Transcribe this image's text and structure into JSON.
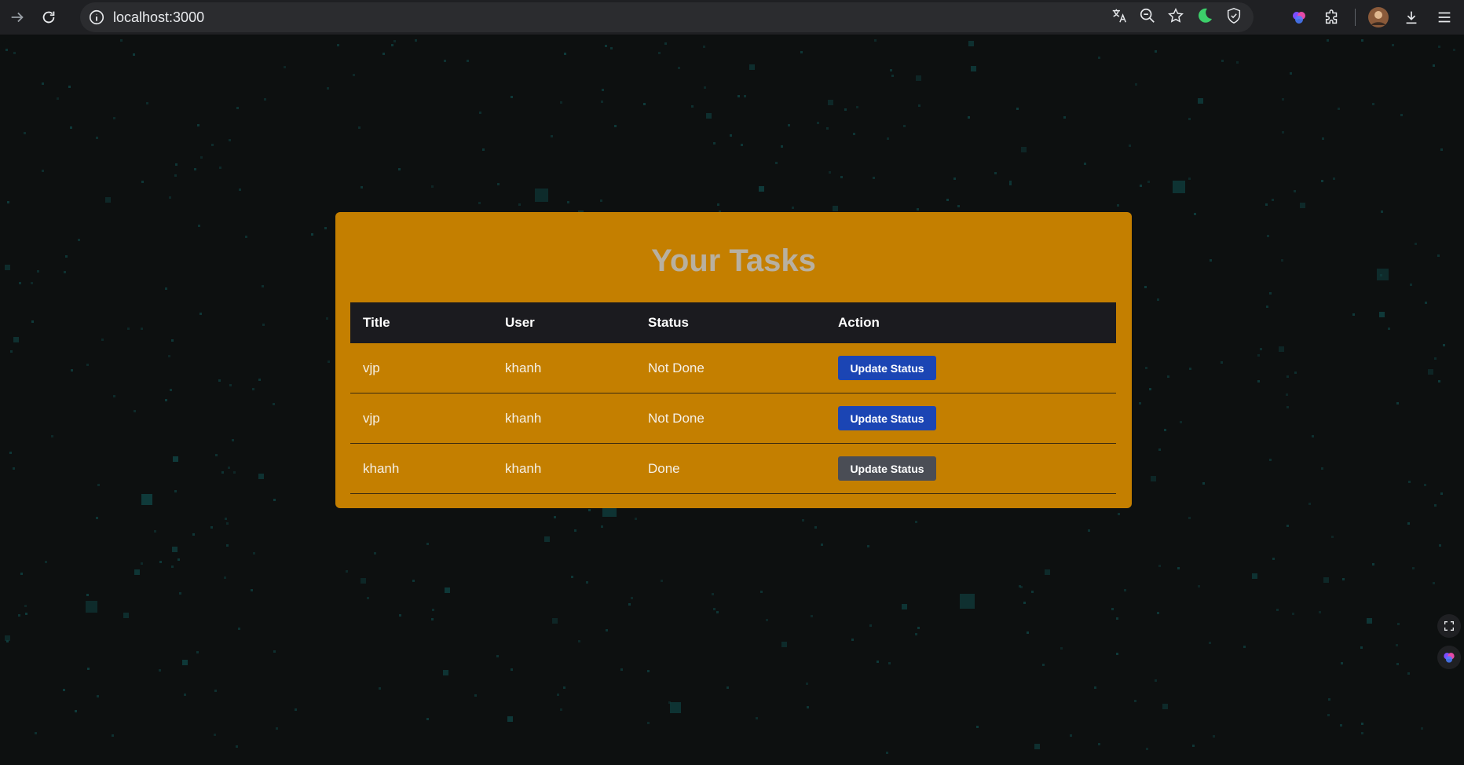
{
  "browser": {
    "url": "localhost:3000"
  },
  "page": {
    "title": "Your Tasks",
    "headers": [
      "Title",
      "User",
      "Status",
      "Action"
    ],
    "rows": [
      {
        "title": "vjp",
        "user": "khanh",
        "status": "Not Done",
        "action": "Update Status",
        "button_color": "#1b45b4"
      },
      {
        "title": "vjp",
        "user": "khanh",
        "status": "Not Done",
        "action": "Update Status",
        "button_color": "#1b45b4"
      },
      {
        "title": "khanh",
        "user": "khanh",
        "status": "Done",
        "action": "Update Status",
        "button_color": "#4a4d55"
      }
    ]
  },
  "colors": {
    "card": "#c47f00",
    "header_bg": "#1b1b1f",
    "background": "#0d1010",
    "speck": "#0f3b3b"
  }
}
